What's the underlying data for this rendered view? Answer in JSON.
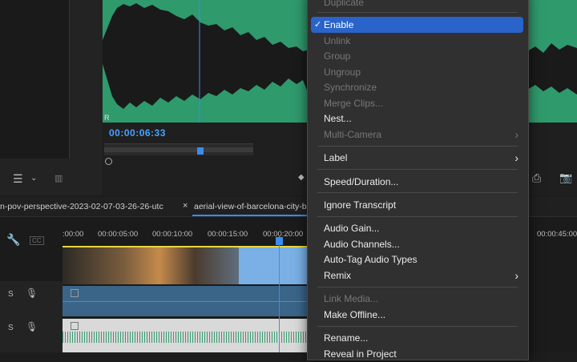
{
  "monitor": {
    "channel_r_label": "R",
    "timecode": "00:00:06:33"
  },
  "tabs": [
    {
      "label": "n-pov-perspective-2023-02-07-03-26-26-utc"
    },
    {
      "close": "×",
      "label": "aerial-view-of-barcelona-city-bu"
    }
  ],
  "ruler": {
    "ticks": [
      ":00:00",
      "00:00:05:00",
      "00:00:10:00",
      "00:00:15:00",
      "00:00:20:00",
      "00:00:45:00"
    ]
  },
  "tracks": [
    {
      "s": "S"
    },
    {
      "s": "S"
    }
  ],
  "context_menu": {
    "items": [
      {
        "label": "Duplicate",
        "state": "disabled"
      },
      {
        "label": "Enable",
        "state": "selected",
        "check": "✓"
      },
      {
        "label": "Unlink",
        "state": "disabled"
      },
      {
        "label": "Group",
        "state": "disabled"
      },
      {
        "label": "Ungroup",
        "state": "disabled"
      },
      {
        "label": "Synchronize",
        "state": "disabled"
      },
      {
        "label": "Merge Clips...",
        "state": "disabled"
      },
      {
        "label": "Nest...",
        "state": "enabled"
      },
      {
        "label": "Multi-Camera",
        "state": "disabled",
        "arrow": "›"
      },
      {
        "label": "Label",
        "state": "enabled",
        "arrow": "›"
      },
      {
        "label": "Speed/Duration...",
        "state": "enabled"
      },
      {
        "label": "Ignore Transcript",
        "state": "enabled"
      },
      {
        "label": "Audio Gain...",
        "state": "enabled"
      },
      {
        "label": "Audio Channels...",
        "state": "enabled"
      },
      {
        "label": "Auto-Tag Audio Types",
        "state": "enabled"
      },
      {
        "label": "Remix",
        "state": "enabled",
        "arrow": "›"
      },
      {
        "label": "Link Media...",
        "state": "disabled"
      },
      {
        "label": "Make Offline...",
        "state": "enabled"
      },
      {
        "label": "Rename...",
        "state": "enabled"
      },
      {
        "label": "Reveal in Project",
        "state": "enabled"
      }
    ]
  }
}
